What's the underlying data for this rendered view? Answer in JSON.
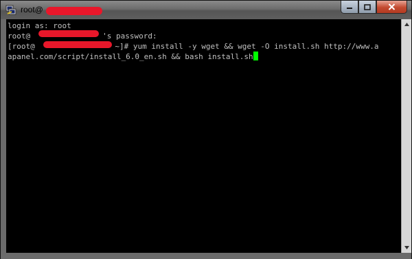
{
  "window": {
    "title": "root@",
    "icons": {
      "app": "putty-icon",
      "minimize": "minimize-icon",
      "maximize": "maximize-icon",
      "close": "close-icon"
    }
  },
  "terminal": {
    "line1": "login as: root",
    "line2_prefix": "root@",
    "line2_suffix": "'s password:",
    "line3_prefix": "[root@",
    "line3_suffix": " ~]# yum install -y wget && wget -O install.sh http://www.a",
    "line4": "apanel.com/script/install_6.0_en.sh && bash install.sh"
  },
  "colors": {
    "redaction": "#e8172a",
    "cursor": "#00ff00",
    "terminal_bg": "#000000",
    "terminal_fg": "#c0c0c0"
  },
  "scrollbar": {
    "up": "scroll-up-arrow",
    "down": "scroll-down-arrow"
  }
}
